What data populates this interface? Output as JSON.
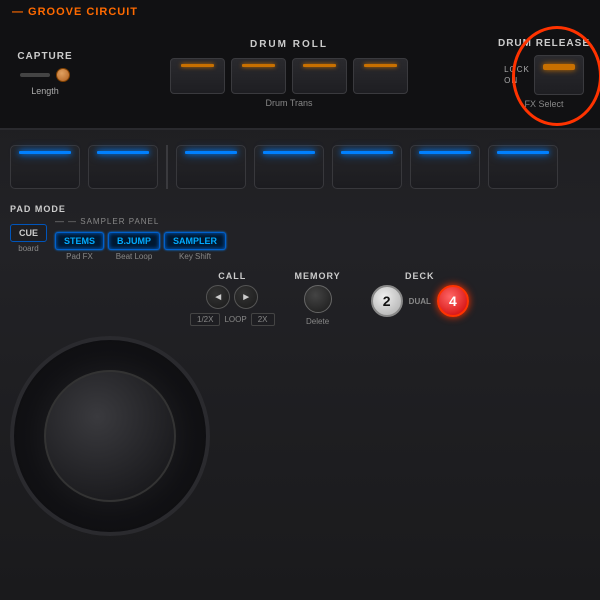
{
  "header": {
    "groove_circuit_label": "— GROOVE CIRCUIT",
    "capture_label": "CAPTURE",
    "length_label": "Length",
    "drum_roll_label": "DRUM ROLL",
    "drum_trans_label": "Drum Trans",
    "drum_release_label": "DRUM RELEASE",
    "lock_label": "LOCK",
    "on_label": "ON",
    "fx_select_label": "FX Select"
  },
  "pads": {
    "row1": [
      "pad1",
      "pad2",
      "pad3",
      "pad4",
      "pad5",
      "pad6",
      "pad7"
    ]
  },
  "pad_mode": {
    "label": "PAD MODE",
    "sampler_panel_label": "— SAMPLER PANEL",
    "buttons": [
      {
        "id": "cue",
        "label": "CUE",
        "sub": "board",
        "active": false,
        "highlight": false
      },
      {
        "id": "stems",
        "label": "STEMS",
        "sub": "Pad FX",
        "active": true,
        "highlight": true
      },
      {
        "id": "bjump",
        "label": "B.JUMP",
        "sub": "Beat Loop",
        "active": true,
        "highlight": true
      },
      {
        "id": "sampler",
        "label": "SAMPLER",
        "sub": "Key Shift",
        "active": true,
        "highlight": true
      }
    ]
  },
  "call": {
    "label": "CALL",
    "left_btn": "◄",
    "right_btn": "►",
    "half_label": "1/2X",
    "loop_label": "LOOP",
    "two_x_label": "2X"
  },
  "memory": {
    "label": "MEMORY",
    "delete_label": "Delete"
  },
  "deck": {
    "label": "DECK",
    "btn2_label": "2",
    "dual_label": "DUAL",
    "btn4_label": "4"
  },
  "colors": {
    "orange": "#ff6a00",
    "blue": "#0080ff",
    "red_circle": "#ff3300",
    "led_orange": "#c87000"
  }
}
